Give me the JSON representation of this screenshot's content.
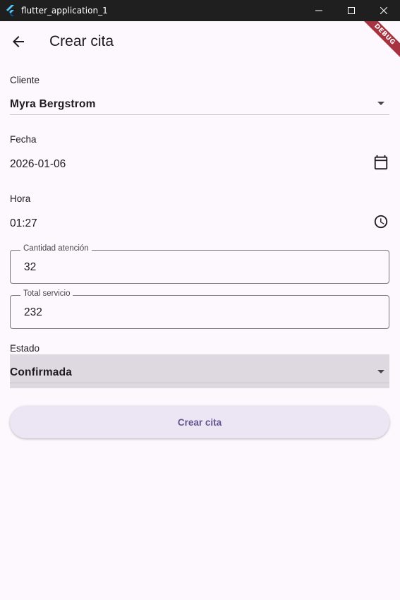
{
  "window": {
    "title": "flutter_application_1",
    "debug_banner": "DEBUG"
  },
  "appbar": {
    "title": "Crear cita"
  },
  "form": {
    "cliente": {
      "label": "Cliente",
      "value": "Myra Bergstrom"
    },
    "fecha": {
      "label": "Fecha",
      "value": "2026-01-06",
      "icon": "calendar-icon"
    },
    "hora": {
      "label": "Hora",
      "value": "01:27",
      "icon": "clock-icon"
    },
    "cantidad": {
      "label": "Cantidad atención",
      "value": "32"
    },
    "total": {
      "label": "Total servicio",
      "value": "232"
    },
    "estado": {
      "label": "Estado",
      "value": "Confirmada"
    },
    "submit_label": "Crear cita"
  },
  "colors": {
    "background": "#fdf7fe",
    "primary": "#65558f",
    "button_bg": "#ebe5f4",
    "debug_ribbon": "#a6333f"
  }
}
